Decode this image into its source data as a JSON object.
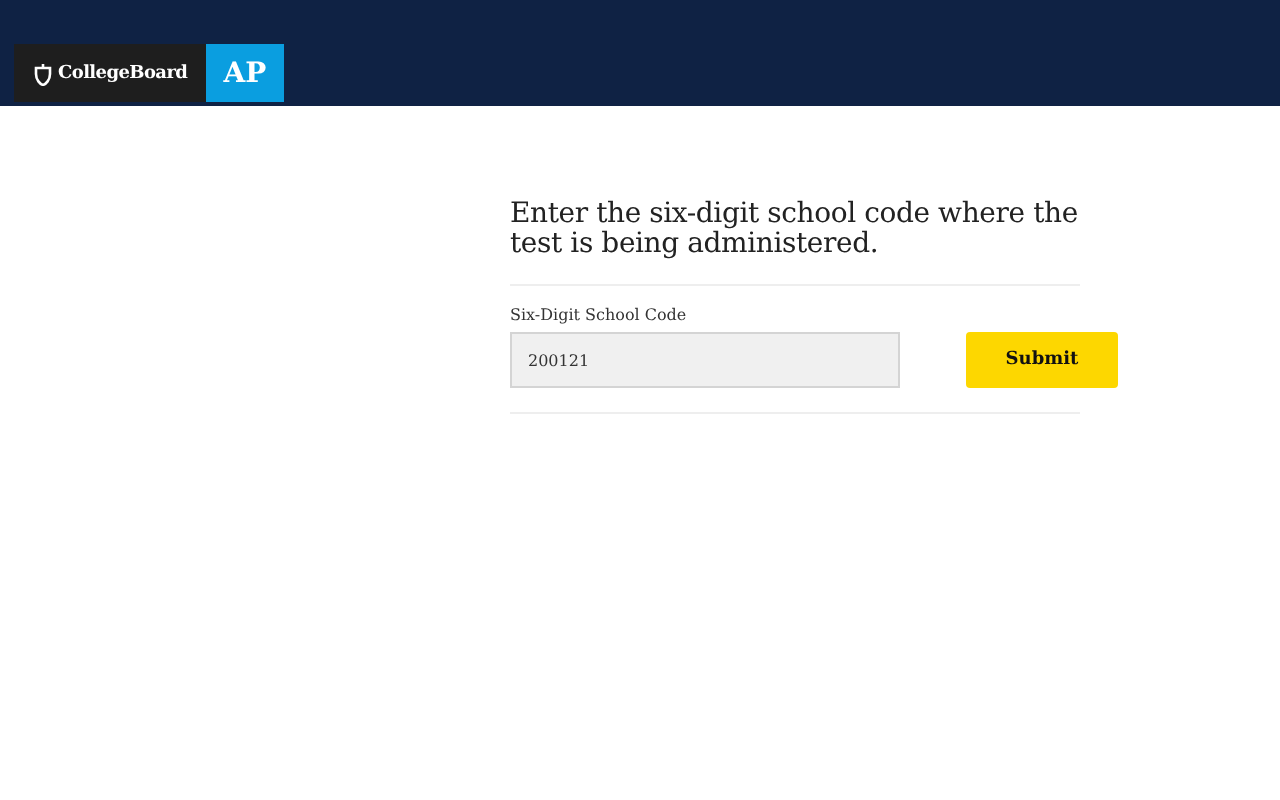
{
  "header": {
    "logo": "CollegeBoard",
    "badge": "AP"
  },
  "form": {
    "heading": "Enter the six-digit school code where the test is being administered.",
    "field_label": "Six-Digit School Code",
    "field_value": "200121",
    "submit": "Submit"
  }
}
